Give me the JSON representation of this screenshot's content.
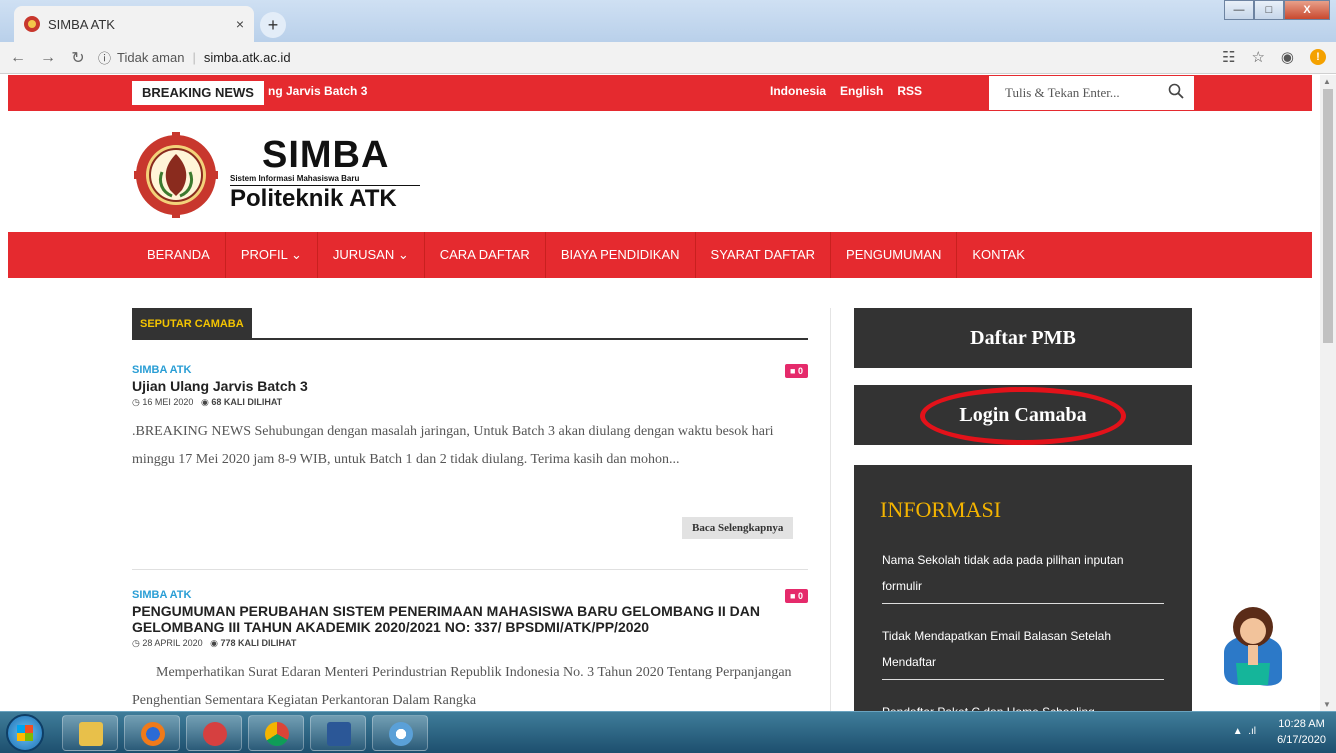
{
  "browser": {
    "tab_title": "SIMBA ATK",
    "tab_close": "×",
    "new_tab": "+",
    "security_label": "Tidak aman",
    "url": "simba.atk.ac.id"
  },
  "topbar": {
    "breaking_label": "BREAKING NEWS",
    "ticker_text": "ng Jarvis Batch 3",
    "lang_id": "Indonesia",
    "lang_en": "English",
    "rss": "RSS",
    "search_placeholder": "Tulis & Tekan Enter..."
  },
  "logo": {
    "title": "SIMBA",
    "subtitle": "Sistem Informasi Mahasiswa Baru",
    "org": "Politeknik ATK"
  },
  "nav": {
    "items": [
      {
        "label": "BERANDA"
      },
      {
        "label": "PROFIL ⌄"
      },
      {
        "label": "JURUSAN ⌄"
      },
      {
        "label": "CARA DAFTAR"
      },
      {
        "label": "BIAYA PENDIDIKAN"
      },
      {
        "label": "SYARAT DAFTAR"
      },
      {
        "label": "PENGUMUMAN"
      },
      {
        "label": "KONTAK"
      }
    ]
  },
  "section": {
    "label": "SEPUTAR CAMABA"
  },
  "articles": [
    {
      "category": "SIMBA ATK",
      "title": "Ujian Ulang Jarvis Batch 3",
      "date": "16 MEI 2020",
      "views": "68 KALI DILIHAT",
      "comments": "0",
      "body": ".BREAKING NEWS Sehubungan dengan masalah jaringan, Untuk Batch 3 akan diulang dengan waktu besok hari minggu 17 Mei 2020 jam 8-9 WIB, untuk Batch 1 dan 2 tidak diulang. Terima kasih dan mohon...",
      "read_more": "Baca Selengkapnya"
    },
    {
      "category": "SIMBA ATK",
      "title": "PENGUMUMAN PERUBAHAN SISTEM PENERIMAAN MAHASISWA BARU GELOMBANG II DAN GELOMBANG III TAHUN AKADEMIK 2020/2021 NO: 337/ BPSDMI/ATK/PP/2020",
      "date": "28 APRIL 2020",
      "views": "778 KALI DILIHAT",
      "comments": "0",
      "body": "Memperhatikan Surat Edaran Menteri Perindustrian Republik Indonesia No. 3 Tahun 2020 Tentang Perpanjangan Penghentian Sementara Kegiatan Perkantoran Dalam Rangka"
    }
  ],
  "sidebar": {
    "daftar_label": "Daftar PMB",
    "login_label": "Login Camaba",
    "info_title": "INFORMASI",
    "info_items": [
      "Nama Sekolah tidak ada pada pilihan inputan formulir",
      "Tidak Mendapatkan Email Balasan Setelah Mendaftar",
      "Pendaftar Paket C dan Home Schooling"
    ]
  },
  "taskbar": {
    "time": "10:28 AM",
    "date": "6/17/2020"
  },
  "colors": {
    "brand_red": "#e52a2f",
    "dark": "#333333",
    "gold": "#f4b400",
    "link_blue": "#2a9ed5"
  }
}
